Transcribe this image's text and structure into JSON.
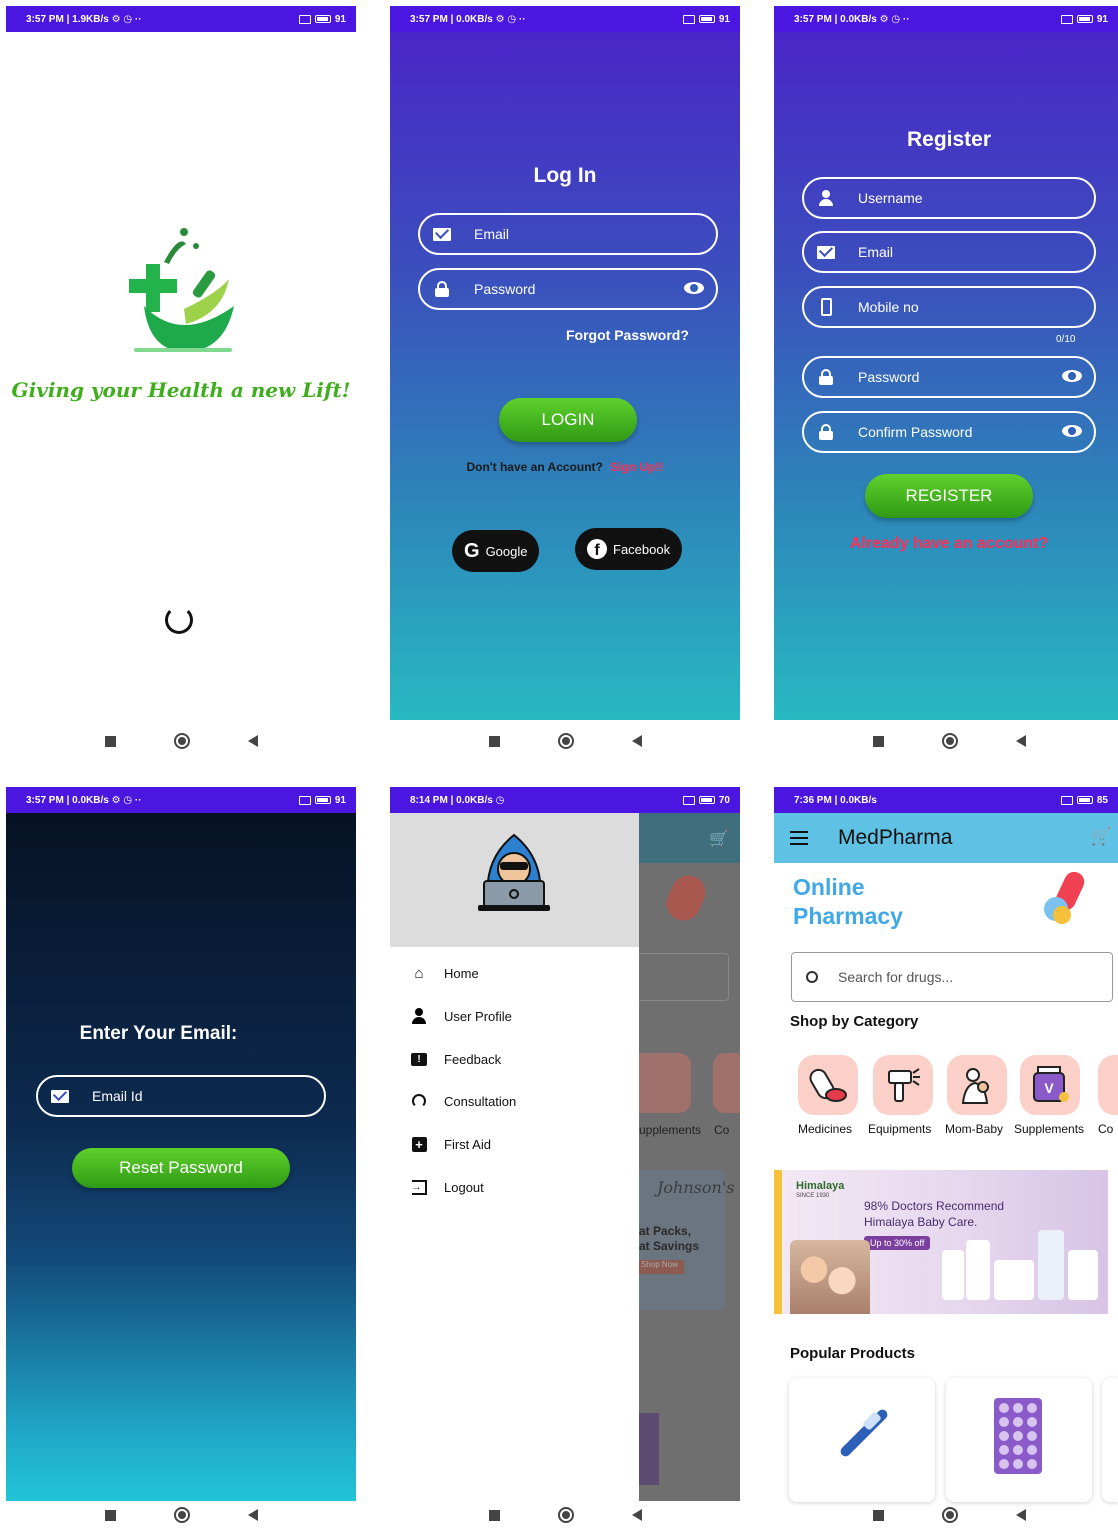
{
  "screen1": {
    "status": {
      "left": "3:57 PM | 1.9KB/s ⚙ ◷ ··",
      "battery": "91"
    },
    "tagline": "Giving your Health a new Lift!"
  },
  "screen2": {
    "status": {
      "left": "3:57 PM | 0.0KB/s ⚙ ◷ ··",
      "battery": "91"
    },
    "title": "Log In",
    "email_placeholder": "Email",
    "password_placeholder": "Password",
    "forgot": "Forgot Password?",
    "login_label": "LOGIN",
    "no_account": "Don't have an Account?",
    "signup": "Sign Up!!",
    "google": "Google",
    "facebook": "Facebook"
  },
  "screen3": {
    "status": {
      "left": "3:57 PM | 0.0KB/s ⚙ ◷ ··",
      "battery": "91"
    },
    "title": "Register",
    "username": "Username",
    "email": "Email",
    "mobile": "Mobile no",
    "counter": "0/10",
    "password": "Password",
    "confirm_password": "Confirm Password",
    "register_label": "REGISTER",
    "already": "Already have an account?"
  },
  "screen4": {
    "status": {
      "left": "3:57 PM | 0.0KB/s ⚙ ◷ ··",
      "battery": "91"
    },
    "title": "Enter Your Email:",
    "email_placeholder": "Email Id",
    "reset_label": "Reset Password"
  },
  "screen5": {
    "status": {
      "left": "8:14 PM | 0.0KB/s ◷",
      "battery": "70"
    },
    "menu": [
      "Home",
      "User Profile",
      "Feedback",
      "Consultation",
      "First Aid",
      "Logout"
    ],
    "peek": {
      "cat1": "upplements",
      "cat2": "Co",
      "promo_brand": "Johnson's",
      "promo_line1": "at Packs,",
      "promo_line2": "at Savings",
      "promo_btn": "Shop Now"
    }
  },
  "screen6": {
    "status": {
      "left": "7:36 PM | 0.0KB/s",
      "battery": "85"
    },
    "app_title": "MedPharma",
    "hero_line1": "Online",
    "hero_line2": "Pharmacy",
    "search_placeholder": "Search for drugs...",
    "shop_by_category": "Shop by Category",
    "categories": [
      "Medicines",
      "Equipments",
      "Mom-Baby",
      "Supplements",
      "Co"
    ],
    "banner": {
      "brand": "Himalaya",
      "since": "SINCE 1930",
      "line1": "98% Doctors Recommend",
      "line2": "Himalaya Baby Care.",
      "offer": "Up to 30% off"
    },
    "popular_products": "Popular Products"
  },
  "colors": {
    "status_bar": "#4b16e0",
    "accent_green": "#3fae1d",
    "link_red": "#ff2d55",
    "app_bar": "#5fc1e3",
    "hero_blue": "#40a8e6"
  }
}
